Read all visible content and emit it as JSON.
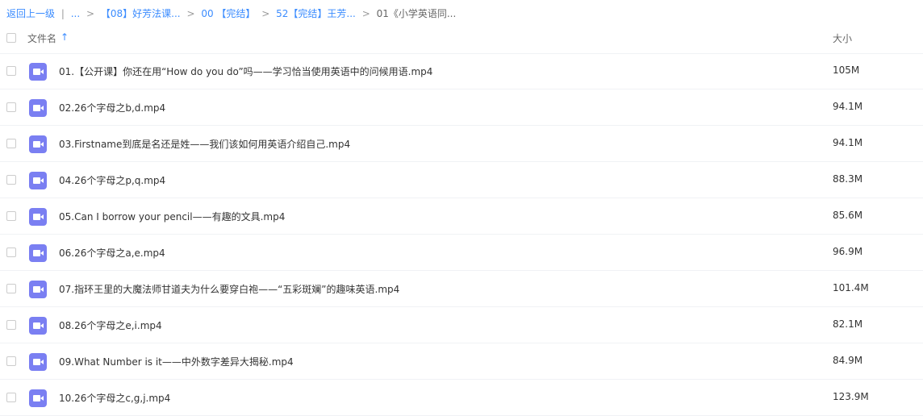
{
  "breadcrumb": {
    "back": "返回上一级",
    "sep_pipe": "|",
    "ellipsis": "...",
    "sep": ">",
    "items": [
      "【08】好芳法课...",
      "00 【完结】",
      "52【完结】王芳...",
      "01《小学英语同..."
    ]
  },
  "header": {
    "name_label": "文件名",
    "sort_icon": "↑",
    "size_label": "大小"
  },
  "files": [
    {
      "name": "01.【公开课】你还在用“How do you do”吗——学习恰当使用英语中的问候用语.mp4",
      "size": "105M"
    },
    {
      "name": "02.26个字母之b,d.mp4",
      "size": "94.1M"
    },
    {
      "name": "03.Firstname到底是名还是姓——我们该如何用英语介绍自己.mp4",
      "size": "94.1M"
    },
    {
      "name": "04.26个字母之p,q.mp4",
      "size": "88.3M"
    },
    {
      "name": "05.Can I borrow your pencil——有趣的文具.mp4",
      "size": "85.6M"
    },
    {
      "name": "06.26个字母之a,e.mp4",
      "size": "96.9M"
    },
    {
      "name": "07.指环王里的大魔法师甘道夫为什么要穿白袍——“五彩斑斓”的趣味英语.mp4",
      "size": "101.4M"
    },
    {
      "name": "08.26个字母之e,i.mp4",
      "size": "82.1M"
    },
    {
      "name": "09.What Number is it——中外数字差异大揭秘.mp4",
      "size": "84.9M"
    },
    {
      "name": "10.26个字母之c,g,j.mp4",
      "size": "123.9M"
    }
  ]
}
